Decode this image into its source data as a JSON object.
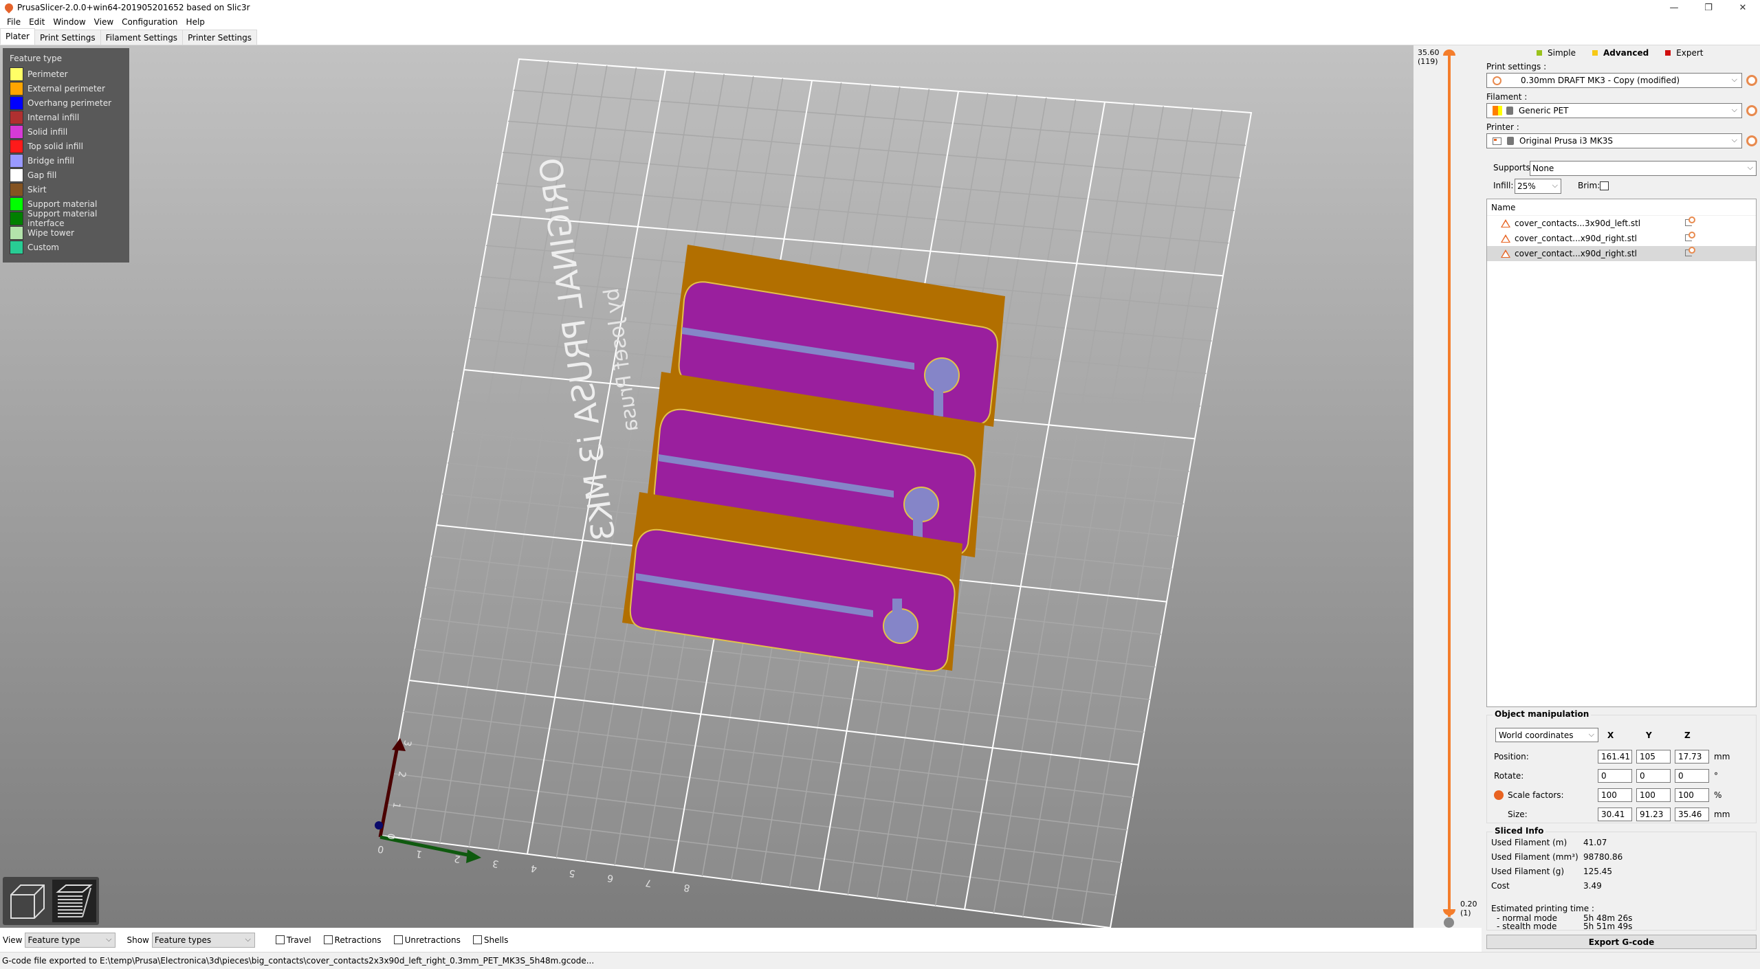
{
  "window": {
    "title": "PrusaSlicer-2.0.0+win64-201905201652 based on Slic3r",
    "controls": [
      "—",
      "❐",
      "✕"
    ]
  },
  "menu": [
    "File",
    "Edit",
    "Window",
    "View",
    "Configuration",
    "Help"
  ],
  "tabs": [
    {
      "label": "Plater",
      "active": true
    },
    {
      "label": "Print Settings",
      "active": false
    },
    {
      "label": "Filament Settings",
      "active": false
    },
    {
      "label": "Printer Settings",
      "active": false
    }
  ],
  "legend": {
    "title": "Feature type",
    "items": [
      {
        "label": "Perimeter",
        "color": "#ffff66"
      },
      {
        "label": "External perimeter",
        "color": "#ffa500"
      },
      {
        "label": "Overhang perimeter",
        "color": "#0000ff"
      },
      {
        "label": "Internal infill",
        "color": "#b03030"
      },
      {
        "label": "Solid infill",
        "color": "#d63ad6"
      },
      {
        "label": "Top solid infill",
        "color": "#ff1a1a"
      },
      {
        "label": "Bridge infill",
        "color": "#9999ff"
      },
      {
        "label": "Gap fill",
        "color": "#ffffff"
      },
      {
        "label": "Skirt",
        "color": "#845321"
      },
      {
        "label": "Support material",
        "color": "#00ff00"
      },
      {
        "label": "Support material interface",
        "color": "#008000"
      },
      {
        "label": "Wipe tower",
        "color": "#b3e3ab"
      },
      {
        "label": "Custom",
        "color": "#28cc94"
      }
    ]
  },
  "bed": {
    "logo_text": "ORIGINAL PRUSA i3 MK3",
    "sub_text": "by Josef Prusa",
    "x_ticks": [
      "0",
      "1",
      "2",
      "3",
      "4",
      "5",
      "6",
      "7",
      "8"
    ],
    "y_ticks": [
      "0",
      "1",
      "2",
      "3"
    ]
  },
  "layer_slider": {
    "top_value": "35.60",
    "top_layer": "(119)",
    "bottom_value": "0.20",
    "bottom_layer": "(1)"
  },
  "modes": [
    {
      "label": "Simple",
      "color": "#9ac21c",
      "active": false
    },
    {
      "label": "Advanced",
      "color": "#f7c916",
      "active": true
    },
    {
      "label": "Expert",
      "color": "#d00e0e",
      "active": false
    }
  ],
  "presets": {
    "print_label": "Print settings :",
    "print_value": "0.30mm DRAFT MK3 - Copy (modified)",
    "filament_label": "Filament :",
    "filament_value": "Generic PET",
    "printer_label": "Printer :",
    "printer_value": "Original Prusa i3 MK3S",
    "supports_label": "Supports:",
    "supports_value": "None",
    "infill_label": "Infill:",
    "infill_value": "25%",
    "brim_label": "Brim:",
    "brim_checked": false
  },
  "object_list": {
    "header": "Name",
    "items": [
      {
        "name": "cover_contacts...3x90d_left.stl",
        "selected": false
      },
      {
        "name": "cover_contact...x90d_right.stl",
        "selected": false
      },
      {
        "name": "cover_contact...x90d_right.stl",
        "selected": true
      }
    ]
  },
  "object_manipulation": {
    "title": "Object manipulation",
    "coord_system": "World coordinates",
    "axes": [
      "X",
      "Y",
      "Z"
    ],
    "rows": [
      {
        "label": "Position:",
        "values": [
          "161.41",
          "105",
          "17.73"
        ],
        "unit": "mm"
      },
      {
        "label": "Rotate:",
        "values": [
          "0",
          "0",
          "0"
        ],
        "unit": "°"
      },
      {
        "label": "Scale factors:",
        "values": [
          "100",
          "100",
          "100"
        ],
        "unit": "%"
      },
      {
        "label": "Size:",
        "values": [
          "30.41",
          "91.23",
          "35.46"
        ],
        "unit": "mm"
      }
    ]
  },
  "sliced_info": {
    "title": "Sliced Info",
    "rows": [
      {
        "label": "Used Filament (m)",
        "value": "41.07"
      },
      {
        "label": "Used Filament (mm³)",
        "value": "98780.86"
      },
      {
        "label": "Used Filament (g)",
        "value": "125.45"
      },
      {
        "label": "Cost",
        "value": "3.49"
      }
    ],
    "time_label": "Estimated printing time :",
    "normal_label": "- normal mode",
    "normal_value": "5h 48m 26s",
    "stealth_label": "- stealth mode",
    "stealth_value": "5h 51m 49s"
  },
  "export_button": "Export G-code",
  "bottom_toolbar": {
    "view_label": "View",
    "view_value": "Feature type",
    "show_label": "Show",
    "show_value": "Feature types",
    "checkboxes": [
      {
        "label": "Travel",
        "checked": false
      },
      {
        "label": "Retractions",
        "checked": false
      },
      {
        "label": "Unretractions",
        "checked": false
      },
      {
        "label": "Shells",
        "checked": false
      }
    ]
  },
  "status": "G-code file exported to E:\\temp\\Prusa\\Electronica\\3d\\pieces\\big_contacts\\cover_contacts2x3x90d_left_right_0.3mm_PET_MK3S_5h48m.gcode..."
}
